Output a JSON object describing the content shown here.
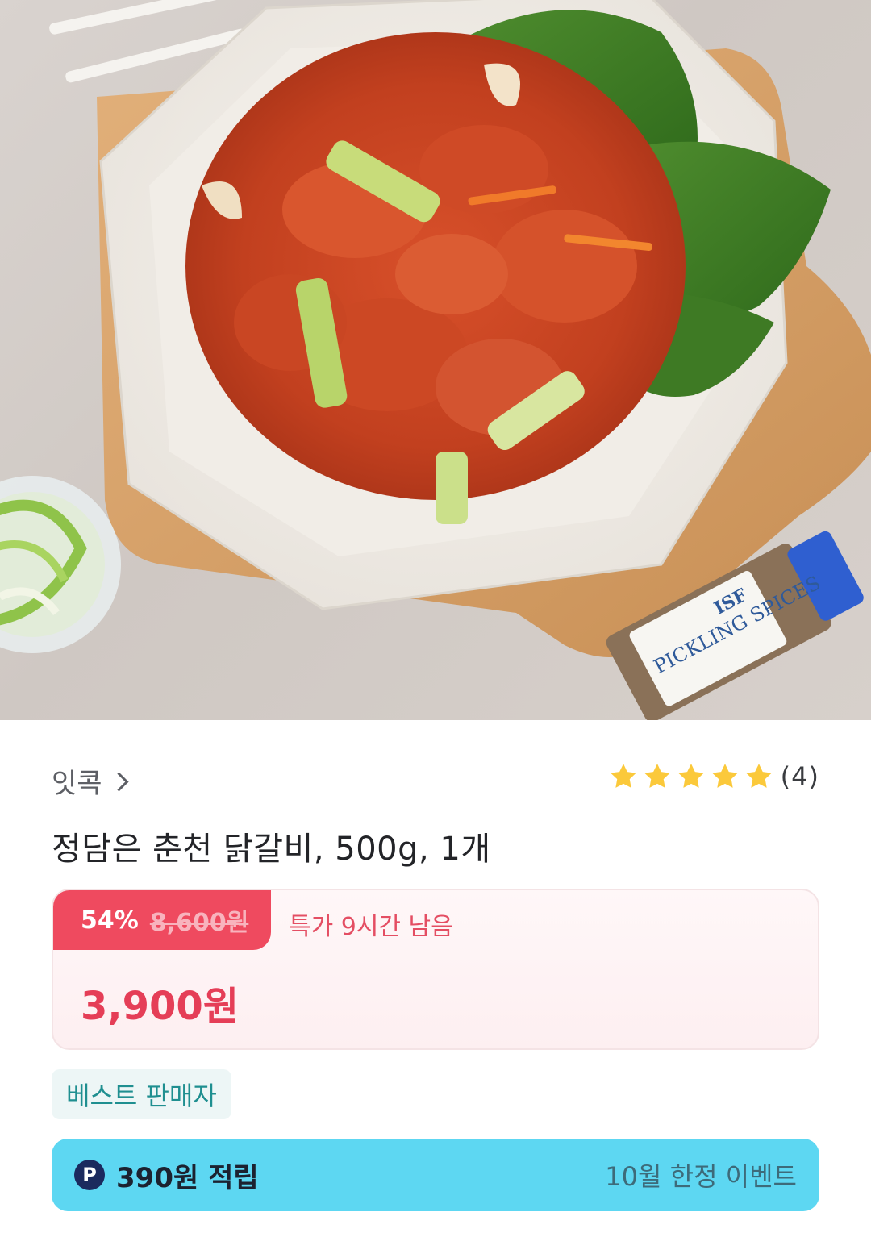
{
  "product_image": {
    "label_text": "PICKLING SPICES",
    "brand_text": "ISF"
  },
  "seller": {
    "name": "잇콕"
  },
  "rating": {
    "stars": 5,
    "count_label": "(4)"
  },
  "product": {
    "title": "정담은 춘천 닭갈비, 500g, 1개"
  },
  "price": {
    "discount_percent": "54%",
    "original_price": "8,600원",
    "deal_timer": "특가 9시간 남음",
    "sale_price": "3,900원"
  },
  "badge": {
    "label": "베스트 판매자"
  },
  "points": {
    "icon_letter": "P",
    "text": "390원 적립",
    "event": "10월 한정 이벤트"
  },
  "colors": {
    "accent_red": "#ef4a5f",
    "sale_red": "#e53e57",
    "star_yellow": "#fbc93b",
    "badge_teal": "#1f8f90",
    "points_cyan": "#5dd7f2"
  }
}
